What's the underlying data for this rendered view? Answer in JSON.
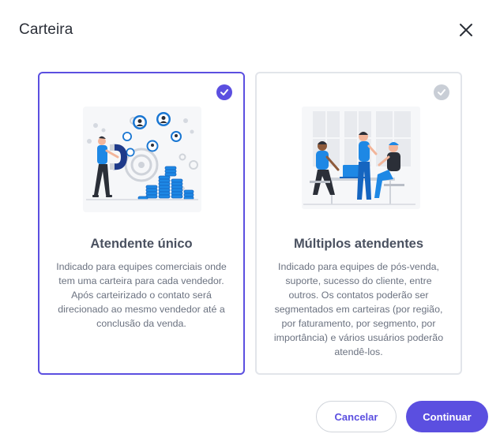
{
  "dialog": {
    "title": "Carteira",
    "close_icon": "close-icon"
  },
  "options": [
    {
      "title": "Atendente único",
      "description": "Indicado para equipes comerciais onde tem uma carteira para cada vendedor. Após carteirizado o contato será direcionado ao mesmo vendedor até a conclusão da venda.",
      "selected": true,
      "illustration_icon": "magnet-attracting-contacts-illustration"
    },
    {
      "title": "Múltiplos atendentes",
      "description": "Indicado para equipes de pós-venda, suporte, sucesso do cliente, entre outros. Os contatos poderão ser segmentados em carteiras (por região, por faturamento, por segmento, por importância) e vários usuários poderão atendê-los.",
      "selected": false,
      "illustration_icon": "team-meeting-illustration"
    }
  ],
  "footer": {
    "cancel_label": "Cancelar",
    "continue_label": "Continuar"
  },
  "colors": {
    "accent": "#5b4fe0",
    "card_border": "#e2e5ea",
    "check_off": "#c9ced6"
  }
}
